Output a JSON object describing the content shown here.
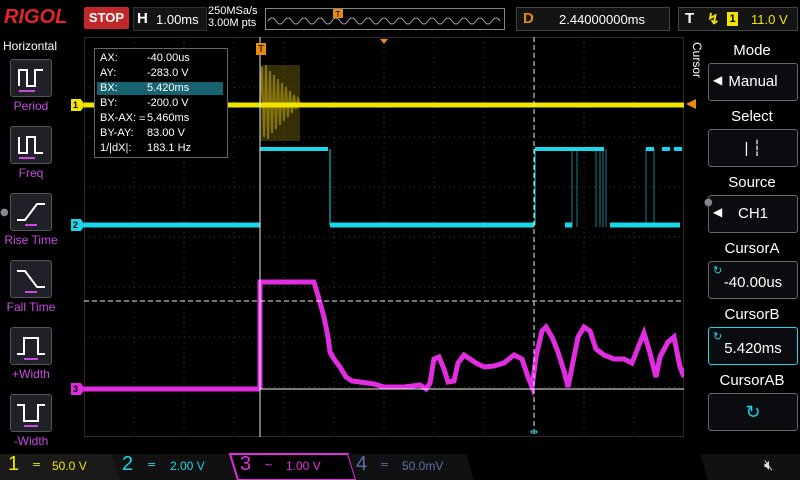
{
  "topbar": {
    "logo": "RIGOL",
    "run_state": "STOP",
    "timebase_letter": "H",
    "timebase": "1.00ms",
    "sample_rate": "250MSa/s",
    "memory_depth": "3.00M pts",
    "delay_letter": "D",
    "delay": "2.44000000ms",
    "trigger_letter": "T",
    "trigger_source": "1",
    "trigger_level": "11.0 V"
  },
  "left_menu": {
    "title": "Horizontal",
    "items": [
      {
        "label": "Period",
        "icon": "period-measure-icon"
      },
      {
        "label": "Freq",
        "icon": "frequency-measure-icon"
      },
      {
        "label": "Rise Time",
        "icon": "rise-time-icon"
      },
      {
        "label": "Fall Time",
        "icon": "fall-time-icon"
      },
      {
        "label": "+Width",
        "icon": "positive-width-icon"
      },
      {
        "label": "-Width",
        "icon": "negative-width-icon"
      }
    ]
  },
  "right_menu": {
    "title": "Cursor",
    "items": [
      {
        "header": "Mode",
        "value": "Manual"
      },
      {
        "header": "Select",
        "value": "| ┆"
      },
      {
        "header": "Source",
        "value": "CH1"
      },
      {
        "header": "CursorA",
        "value": "-40.00us"
      },
      {
        "header": "CursorB",
        "value": "5.420ms"
      },
      {
        "header": "CursorAB",
        "value": ""
      }
    ]
  },
  "measurements": [
    {
      "key": "AX:",
      "value": "-40.00us"
    },
    {
      "key": "AY:",
      "value": "-283.0 V"
    },
    {
      "key": "BX:",
      "value": "5.420ms"
    },
    {
      "key": "BY:",
      "value": "-200.0 V"
    },
    {
      "key": "BX-AX:",
      "value": "5.460ms"
    },
    {
      "key": "BY-AY:",
      "value": "83.00 V"
    },
    {
      "key": "1/|dX|:",
      "value": "183.1 Hz"
    }
  ],
  "meas_eq": "=",
  "channels": [
    {
      "num": "1",
      "coupling": "=",
      "scale": "50.0 V",
      "color": "#f3e400"
    },
    {
      "num": "2",
      "coupling": "=",
      "scale": "2.00 V",
      "color": "#19d6e8"
    },
    {
      "num": "3",
      "coupling": "~",
      "scale": "1.00 V",
      "color": "#e22ce0"
    },
    {
      "num": "4",
      "coupling": "=",
      "scale": "50.0mV",
      "color": "#5c6ea8"
    }
  ],
  "channel_markers": [
    "1",
    "2",
    "3"
  ],
  "trigger_marker": "T",
  "colors": {
    "ch1": "#f3e400",
    "ch2": "#19d6e8",
    "ch3": "#e22ce0",
    "ch4": "#5c6ea8",
    "accent": "#e88a10",
    "run_stop": "#c0282a"
  }
}
